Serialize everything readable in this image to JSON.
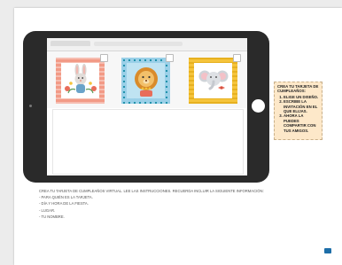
{
  "browser": {
    "tab_title": "",
    "address": ""
  },
  "designs": [
    {
      "name": "bunny-card",
      "frame_color": "#f29a86",
      "accent_color": "#e86d5a"
    },
    {
      "name": "lion-card",
      "frame_color": "#9bd0e8",
      "accent_color": "#1b8fa8"
    },
    {
      "name": "elephant-card",
      "frame_color": "#f5c43c",
      "accent_color": "#e7b120"
    }
  ],
  "sticky_note": {
    "title": "CREA TU TARJETA DE CUMPLEAÑOS:",
    "steps": [
      "ELIGE UN DISEÑO.",
      "ESCRIBE LA INVITACIÓN EN EL QUE ELIJAS.",
      "AHORA LA PUEDES COMPARTIR CON TUS AMIGOS."
    ]
  },
  "instructions": {
    "intro": "CREA TU TARJETA DE CUMPLEAÑOS VIRTUAL. LEE LAS INSTRUCCIONES. RECUERDA INCLUIR LA SIGUIENTE INFORMACIÓN:",
    "items": [
      "- PARA QUIÉN ES LA TARJETA.",
      "- DÍA Y HORA DE LA FIESTA.",
      "- LUGAR.",
      "- TU NOMBRE."
    ]
  },
  "colors": {
    "tablet": "#2a2a2a",
    "sticky_bg": "#fde8c9",
    "badge": "#1d6ea8"
  }
}
